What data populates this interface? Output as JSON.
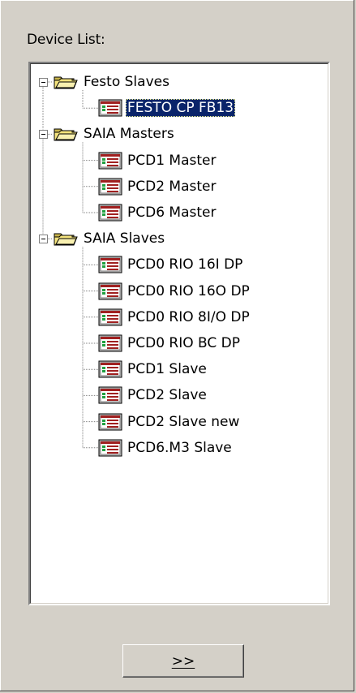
{
  "device_list": {
    "label": "Device List:",
    "groups": [
      {
        "label": "Festo Slaves",
        "icon": "folder-open-icon",
        "children": [
          {
            "label": "FESTO CP FB13",
            "icon": "device-icon",
            "selected": true
          }
        ]
      },
      {
        "label": "SAIA Masters",
        "icon": "folder-open-icon",
        "children": [
          {
            "label": "PCD1 Master",
            "icon": "device-icon"
          },
          {
            "label": "PCD2 Master",
            "icon": "device-icon"
          },
          {
            "label": "PCD6 Master",
            "icon": "device-icon"
          }
        ]
      },
      {
        "label": "SAIA Slaves",
        "icon": "folder-open-icon",
        "children": [
          {
            "label": "PCD0 RIO 16I DP",
            "icon": "device-icon"
          },
          {
            "label": "PCD0 RIO 16O DP",
            "icon": "device-icon"
          },
          {
            "label": "PCD0 RIO 8I/O DP",
            "icon": "device-icon"
          },
          {
            "label": "PCD0 RIO BC DP",
            "icon": "device-icon"
          },
          {
            "label": "PCD1 Slave",
            "icon": "device-icon"
          },
          {
            "label": "PCD2 Slave",
            "icon": "device-icon"
          },
          {
            "label": "PCD2 Slave new",
            "icon": "device-icon"
          },
          {
            "label": "PCD6.M3 Slave",
            "icon": "device-icon"
          }
        ]
      }
    ]
  },
  "add_button": {
    "label": ">>"
  },
  "colors": {
    "window_bg": "#d4d0c8",
    "selection_bg": "#0a246a",
    "selection_fg": "#ffffff"
  }
}
